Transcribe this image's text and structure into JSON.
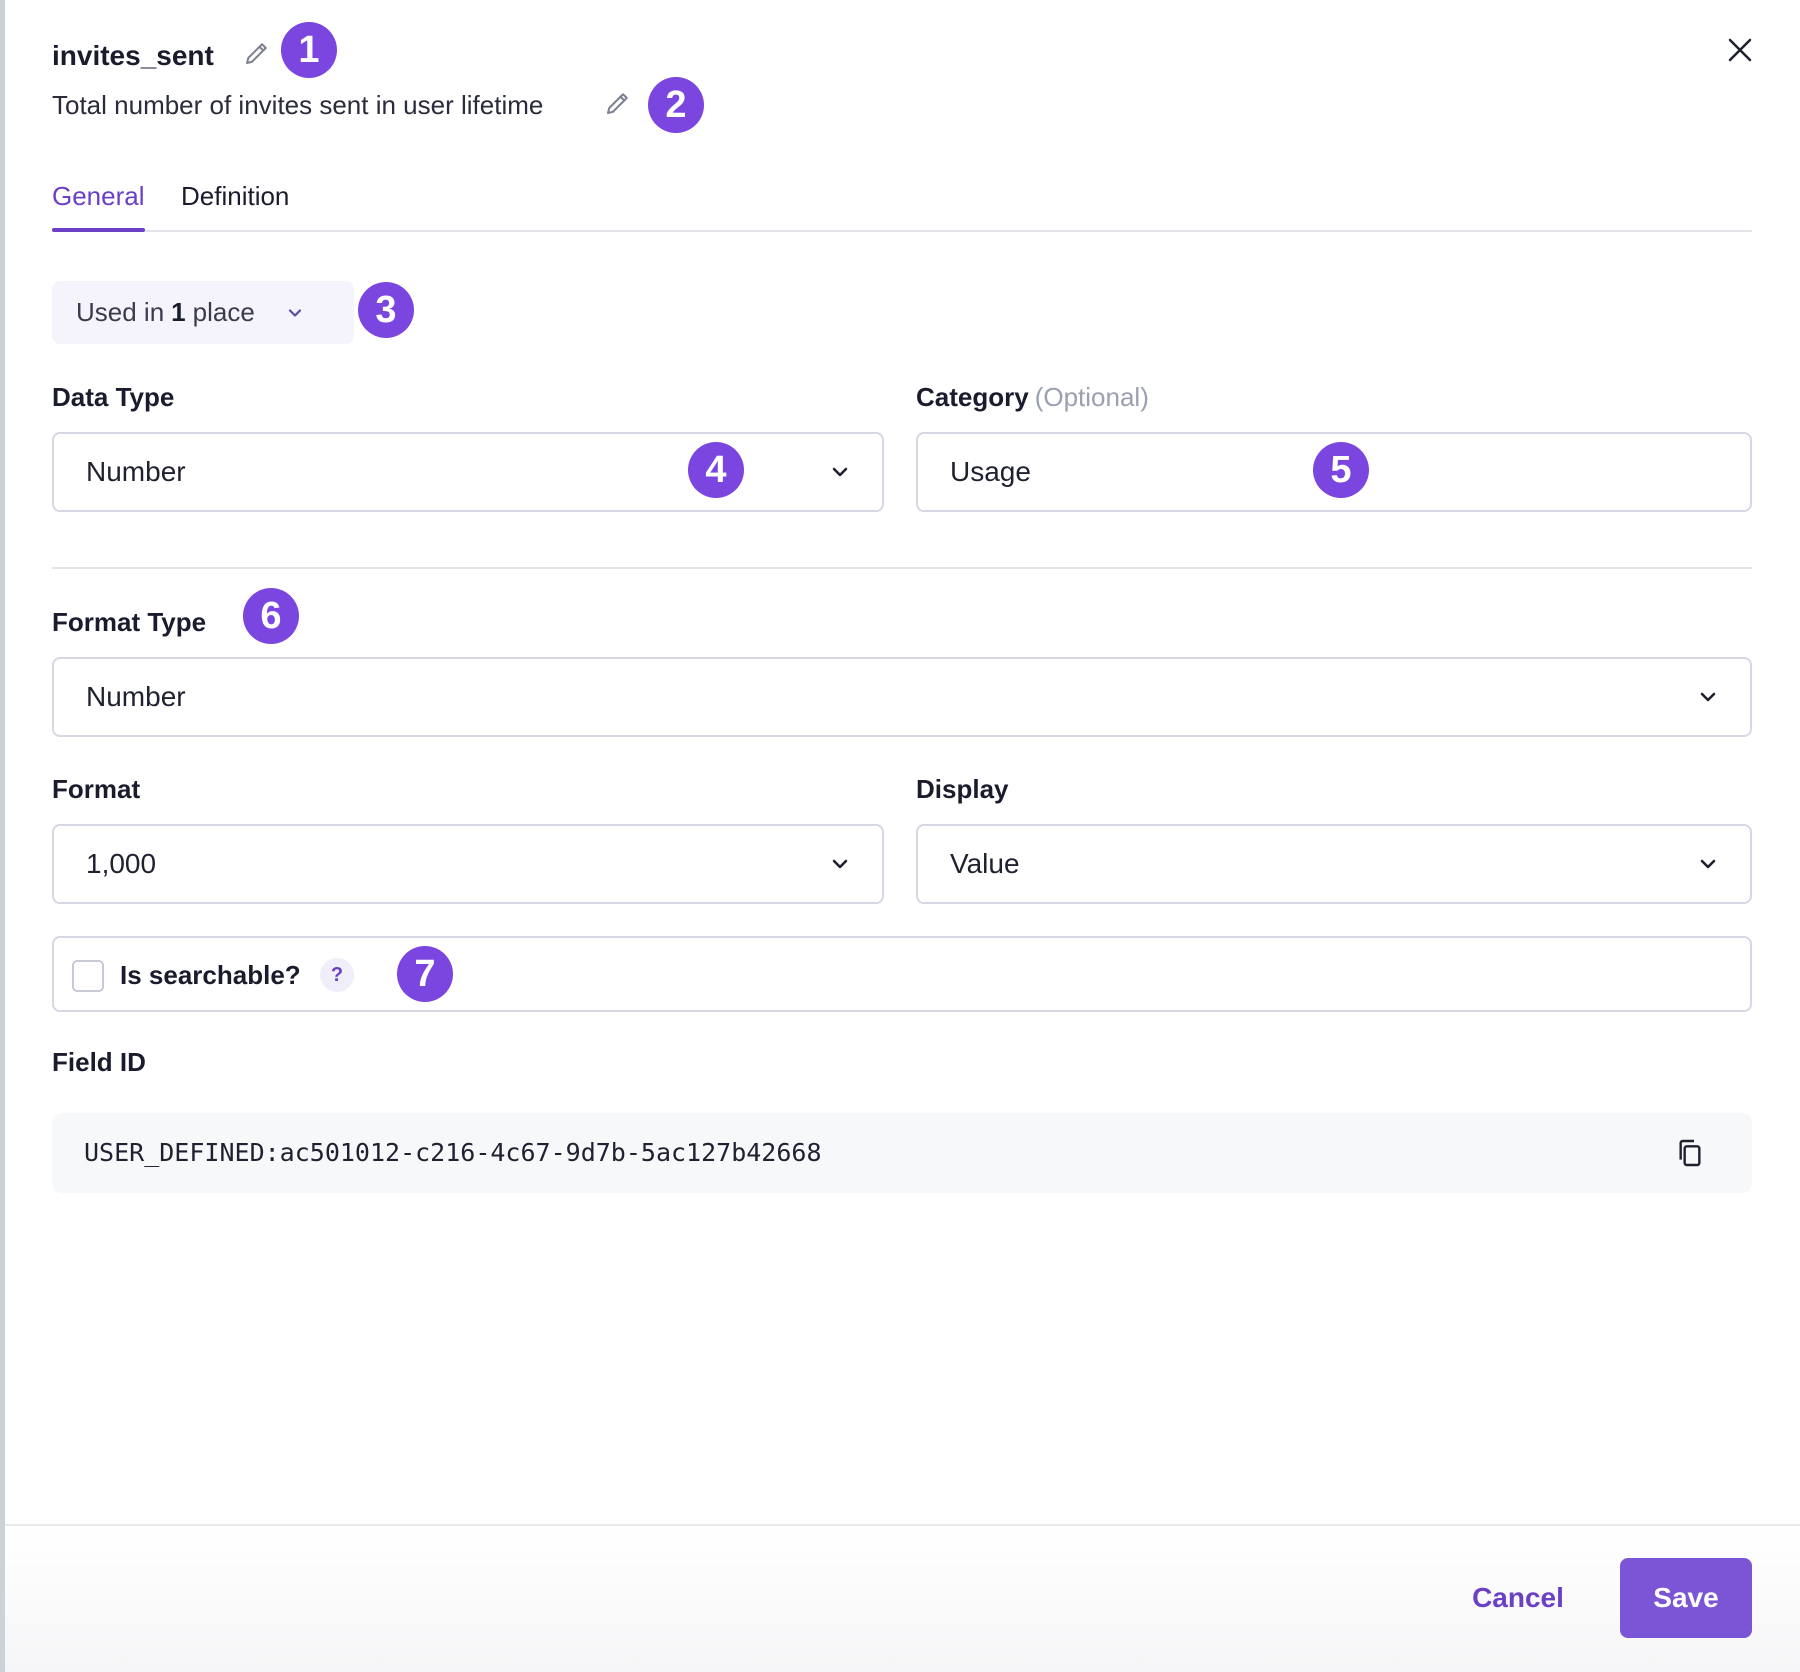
{
  "header": {
    "title": "invites_sent",
    "description": "Total number of invites sent in user lifetime"
  },
  "tabs": [
    {
      "label": "General",
      "active": true
    },
    {
      "label": "Definition",
      "active": false
    }
  ],
  "usage": {
    "prefix": "Used in",
    "count": "1",
    "suffix": "place"
  },
  "badges": [
    "1",
    "2",
    "3",
    "4",
    "5",
    "6",
    "7"
  ],
  "data_type": {
    "label": "Data Type",
    "value": "Number"
  },
  "category": {
    "label": "Category",
    "optional_label": "(Optional)",
    "value": "Usage"
  },
  "format_type": {
    "label": "Format Type",
    "value": "Number"
  },
  "format": {
    "label": "Format",
    "value": "1,000"
  },
  "display": {
    "label": "Display",
    "value": "Value"
  },
  "searchable": {
    "label": "Is searchable?",
    "checked": false,
    "help_glyph": "?"
  },
  "field_id": {
    "label": "Field ID",
    "value": "USER_DEFINED:ac501012-c216-4c67-9d7b-5ac127b42668"
  },
  "footer": {
    "cancel_label": "Cancel",
    "save_label": "Save"
  },
  "colors": {
    "accent": "#6b3fc6",
    "badge": "#7b45e0",
    "save_button": "#7b55d6"
  }
}
